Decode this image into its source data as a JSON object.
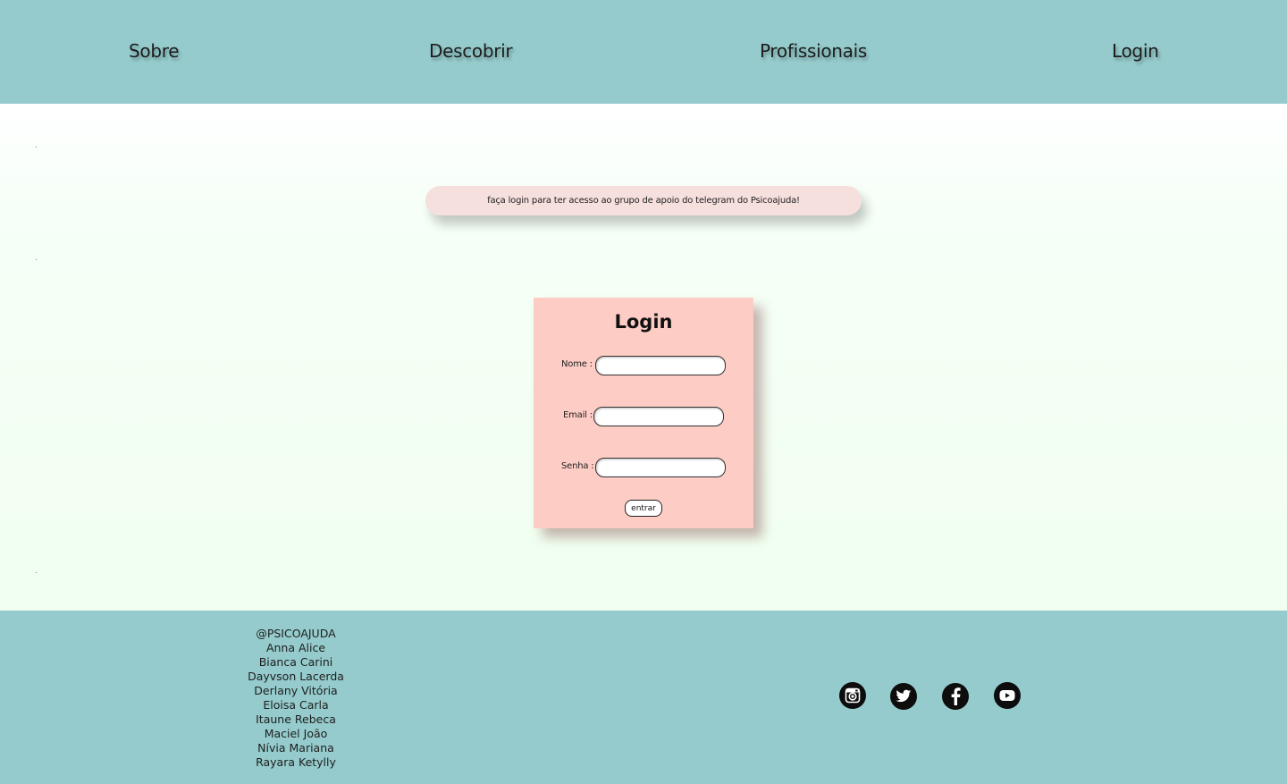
{
  "nav": {
    "items": [
      {
        "label": "Sobre"
      },
      {
        "label": "Descobrir"
      },
      {
        "label": "Profissionais"
      },
      {
        "label": "Login"
      }
    ]
  },
  "notice": {
    "text": "faça login para ter acesso ao grupo de apoio do telegram do Psicoajuda!"
  },
  "login_form": {
    "title": "Login",
    "fields": [
      {
        "label": "Nome :",
        "value": ""
      },
      {
        "label": "Email :",
        "value": ""
      },
      {
        "label": "Senha :",
        "value": ""
      }
    ],
    "submit_label": "entrar"
  },
  "footer": {
    "handle": "@PSICOAJUDA",
    "members": [
      "Anna Alice",
      "Bianca Carini",
      "Dayvson Lacerda",
      "Derlany Vitória",
      "Eloisa Carla",
      "Itaune Rebeca",
      "Maciel João",
      "Nívia Mariana",
      "Rayara Ketylly"
    ],
    "social_icons": [
      "instagram-icon",
      "twitter-icon",
      "facebook-icon",
      "youtube-icon"
    ]
  },
  "colors": {
    "header_footer_bg": "#95cbcc",
    "login_card_bg": "#fdccc5",
    "notice_bg": "#f6e0dd",
    "main_bg": "#f0ffef"
  }
}
